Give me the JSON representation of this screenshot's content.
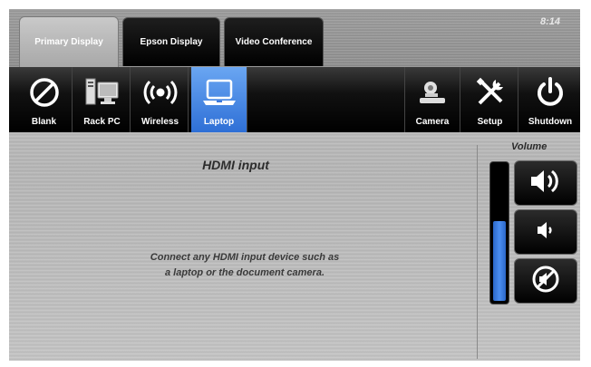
{
  "clock": "8:14",
  "tabs": [
    {
      "label": "Primary Display",
      "active": true
    },
    {
      "label": "Epson Display",
      "active": false
    },
    {
      "label": "Video Conference",
      "active": false
    }
  ],
  "sources": [
    {
      "label": "Blank",
      "icon": "blank-icon",
      "selected": false
    },
    {
      "label": "Rack PC",
      "icon": "rack-pc-icon",
      "selected": false
    },
    {
      "label": "Wireless",
      "icon": "wireless-icon",
      "selected": false
    },
    {
      "label": "Laptop",
      "icon": "laptop-icon",
      "selected": true
    }
  ],
  "tools": [
    {
      "label": "Camera",
      "icon": "camera-icon"
    },
    {
      "label": "Setup",
      "icon": "setup-icon"
    },
    {
      "label": "Shutdown",
      "icon": "power-icon"
    }
  ],
  "main": {
    "title": "HDMI input",
    "message_line1": "Connect any HDMI input device such as",
    "message_line2": "a laptop or the document camera."
  },
  "volume": {
    "label": "Volume",
    "level": 0.6,
    "buttons": [
      "volume-up-icon",
      "volume-down-icon",
      "mute-icon"
    ],
    "accent": "#3a7be0"
  }
}
